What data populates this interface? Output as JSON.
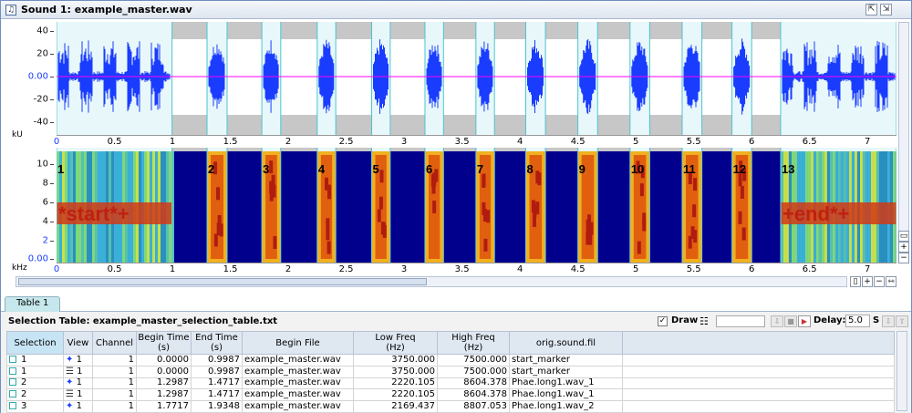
{
  "window": {
    "title": "Sound 1: example_master.wav",
    "icons": [
      "sound-file-icon",
      "undock-icon",
      "dock-icon"
    ]
  },
  "waveform": {
    "y_ticks": [
      "40",
      "20",
      "0.00",
      "-20",
      "-40"
    ],
    "y_unit": "kU",
    "x_ticks": [
      "0",
      "0.5",
      "1",
      "1.5",
      "2",
      "2.5",
      "3",
      "3.5",
      "4",
      "4.5",
      "5",
      "5.5",
      "6",
      "6.5",
      "7"
    ],
    "colors": {
      "wave": "#1a3cff",
      "selection_bg": "#e8f8fa",
      "zero_line": "#ff00ff",
      "background": "#c7c7c7"
    },
    "x_range": [
      0,
      7.25
    ]
  },
  "spectrogram": {
    "y_ticks": [
      "10",
      "8",
      "6",
      "4",
      "2",
      "0.00"
    ],
    "y_unit": "kHz",
    "x_ticks": [
      "0",
      "0.5",
      "1",
      "1.5",
      "2",
      "2.5",
      "3",
      "3.5",
      "4",
      "4.5",
      "5",
      "5.5",
      "6",
      "6.5",
      "7"
    ],
    "selection_labels": [
      "1",
      "2",
      "3",
      "4",
      "5",
      "6",
      "7",
      "8",
      "9",
      "10",
      "11",
      "12",
      "13"
    ],
    "marker_text": [
      "*start*+",
      "+end*+"
    ],
    "colors": {
      "background": "#00008c",
      "energy": "#d23a14"
    }
  },
  "sound_segments": [
    {
      "start": 0.0,
      "end": 0.997
    },
    {
      "start": 1.299,
      "end": 1.472
    },
    {
      "start": 1.772,
      "end": 1.935
    },
    {
      "start": 2.25,
      "end": 2.41
    },
    {
      "start": 2.72,
      "end": 2.88
    },
    {
      "start": 3.18,
      "end": 3.34
    },
    {
      "start": 3.62,
      "end": 3.78
    },
    {
      "start": 4.05,
      "end": 4.22
    },
    {
      "start": 4.5,
      "end": 4.67
    },
    {
      "start": 4.95,
      "end": 5.12
    },
    {
      "start": 5.4,
      "end": 5.57
    },
    {
      "start": 5.83,
      "end": 6.0
    },
    {
      "start": 6.25,
      "end": 7.25
    }
  ],
  "table_tab": {
    "label": "Table 1"
  },
  "table": {
    "title": "Selection Table: example_master_selection_table.txt",
    "draw_label": "Draw",
    "draw_checked": "✓",
    "delay_label": "Delay:",
    "delay_value": "5.0",
    "delay_unit": "S",
    "columns": [
      "Selection",
      "View",
      "Channel",
      "Begin Time\n(s)",
      "End Time\n(s)",
      "Begin File",
      "Low Freq\n(Hz)",
      "High Freq\n(Hz)",
      "orig.sound.fil"
    ],
    "rows": [
      {
        "selection": "1",
        "view_icon": "waveform-view-icon",
        "view": "1",
        "channel": "1",
        "begin": "0.0000",
        "end": "0.9987",
        "file": "example_master.wav",
        "low": "3750.000",
        "high": "7500.000",
        "orig": "start_marker"
      },
      {
        "selection": "1",
        "view_icon": "spectrogram-view-icon",
        "view": "1",
        "channel": "1",
        "begin": "0.0000",
        "end": "0.9987",
        "file": "example_master.wav",
        "low": "3750.000",
        "high": "7500.000",
        "orig": "start_marker"
      },
      {
        "selection": "2",
        "view_icon": "waveform-view-icon",
        "view": "1",
        "channel": "1",
        "begin": "1.2987",
        "end": "1.4717",
        "file": "example_master.wav",
        "low": "2220.105",
        "high": "8604.378",
        "orig": "Phae.long1.wav_1"
      },
      {
        "selection": "2",
        "view_icon": "spectrogram-view-icon",
        "view": "1",
        "channel": "1",
        "begin": "1.2987",
        "end": "1.4717",
        "file": "example_master.wav",
        "low": "2220.105",
        "high": "8604.378",
        "orig": "Phae.long1.wav_1"
      },
      {
        "selection": "3",
        "view_icon": "waveform-view-icon",
        "view": "1",
        "channel": "1",
        "begin": "1.7717",
        "end": "1.9348",
        "file": "example_master.wav",
        "low": "2169.437",
        "high": "8807.053",
        "orig": "Phae.long1.wav_2"
      }
    ]
  }
}
